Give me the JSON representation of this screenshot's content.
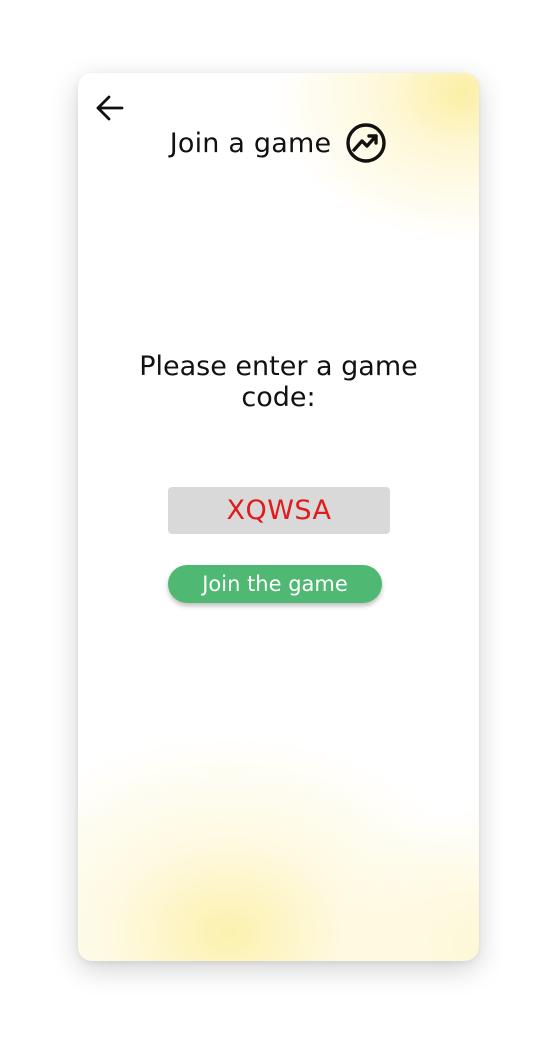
{
  "header": {
    "title": "Join a game",
    "back_icon": "arrow-left-icon",
    "title_icon": "trending-up-circle-icon"
  },
  "main": {
    "prompt": "Please enter a game code:",
    "code_value": "XQWSA",
    "join_button_label": "Join the game"
  },
  "colors": {
    "accent_green": "#4fb873",
    "code_text_red": "#e01b1b",
    "code_box_bg": "#d9d9d9",
    "glow_yellow": "#fcee a0"
  }
}
